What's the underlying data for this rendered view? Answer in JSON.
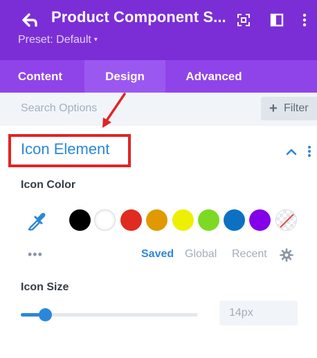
{
  "header": {
    "title": "Product Component S...",
    "preset_label": "Preset: Default"
  },
  "tabs": [
    {
      "label": "Content",
      "active": false
    },
    {
      "label": "Design",
      "active": true
    },
    {
      "label": "Advanced",
      "active": false
    }
  ],
  "search": {
    "placeholder": "Search Options",
    "filter_label": "Filter"
  },
  "section": {
    "title": "Icon Element",
    "highlight_color": "#e32323"
  },
  "icon_color": {
    "label": "Icon Color",
    "swatches": [
      {
        "name": "black",
        "color": "#000000"
      },
      {
        "name": "white",
        "color": "#ffffff"
      },
      {
        "name": "red",
        "color": "#e02b20"
      },
      {
        "name": "orange",
        "color": "#e09900"
      },
      {
        "name": "yellow",
        "color": "#edf000"
      },
      {
        "name": "green",
        "color": "#7cda24"
      },
      {
        "name": "blue",
        "color": "#0c71c3"
      },
      {
        "name": "purple",
        "color": "#8300e9"
      },
      {
        "name": "none",
        "color": "transparent"
      }
    ],
    "palette_tabs": {
      "saved": "Saved",
      "global": "Global",
      "recent": "Recent"
    }
  },
  "icon_size": {
    "label": "Icon Size",
    "value": "14px",
    "slider_fraction": 0.14
  },
  "colors": {
    "header_bg": "#7b2ed6",
    "tab_bar_bg": "#8f44e9",
    "active_tab_bg": "#9b58f0",
    "accent": "#2b87da",
    "annotation_red": "#e32323"
  },
  "icons": {
    "back": "back-arrow-icon",
    "expand": "expand-icon",
    "layout": "layout-icon",
    "more": "kebab-menu-icon",
    "collapse": "chevron-up-icon",
    "eyedropper": "eyedropper-icon",
    "gear": "gear-icon"
  }
}
